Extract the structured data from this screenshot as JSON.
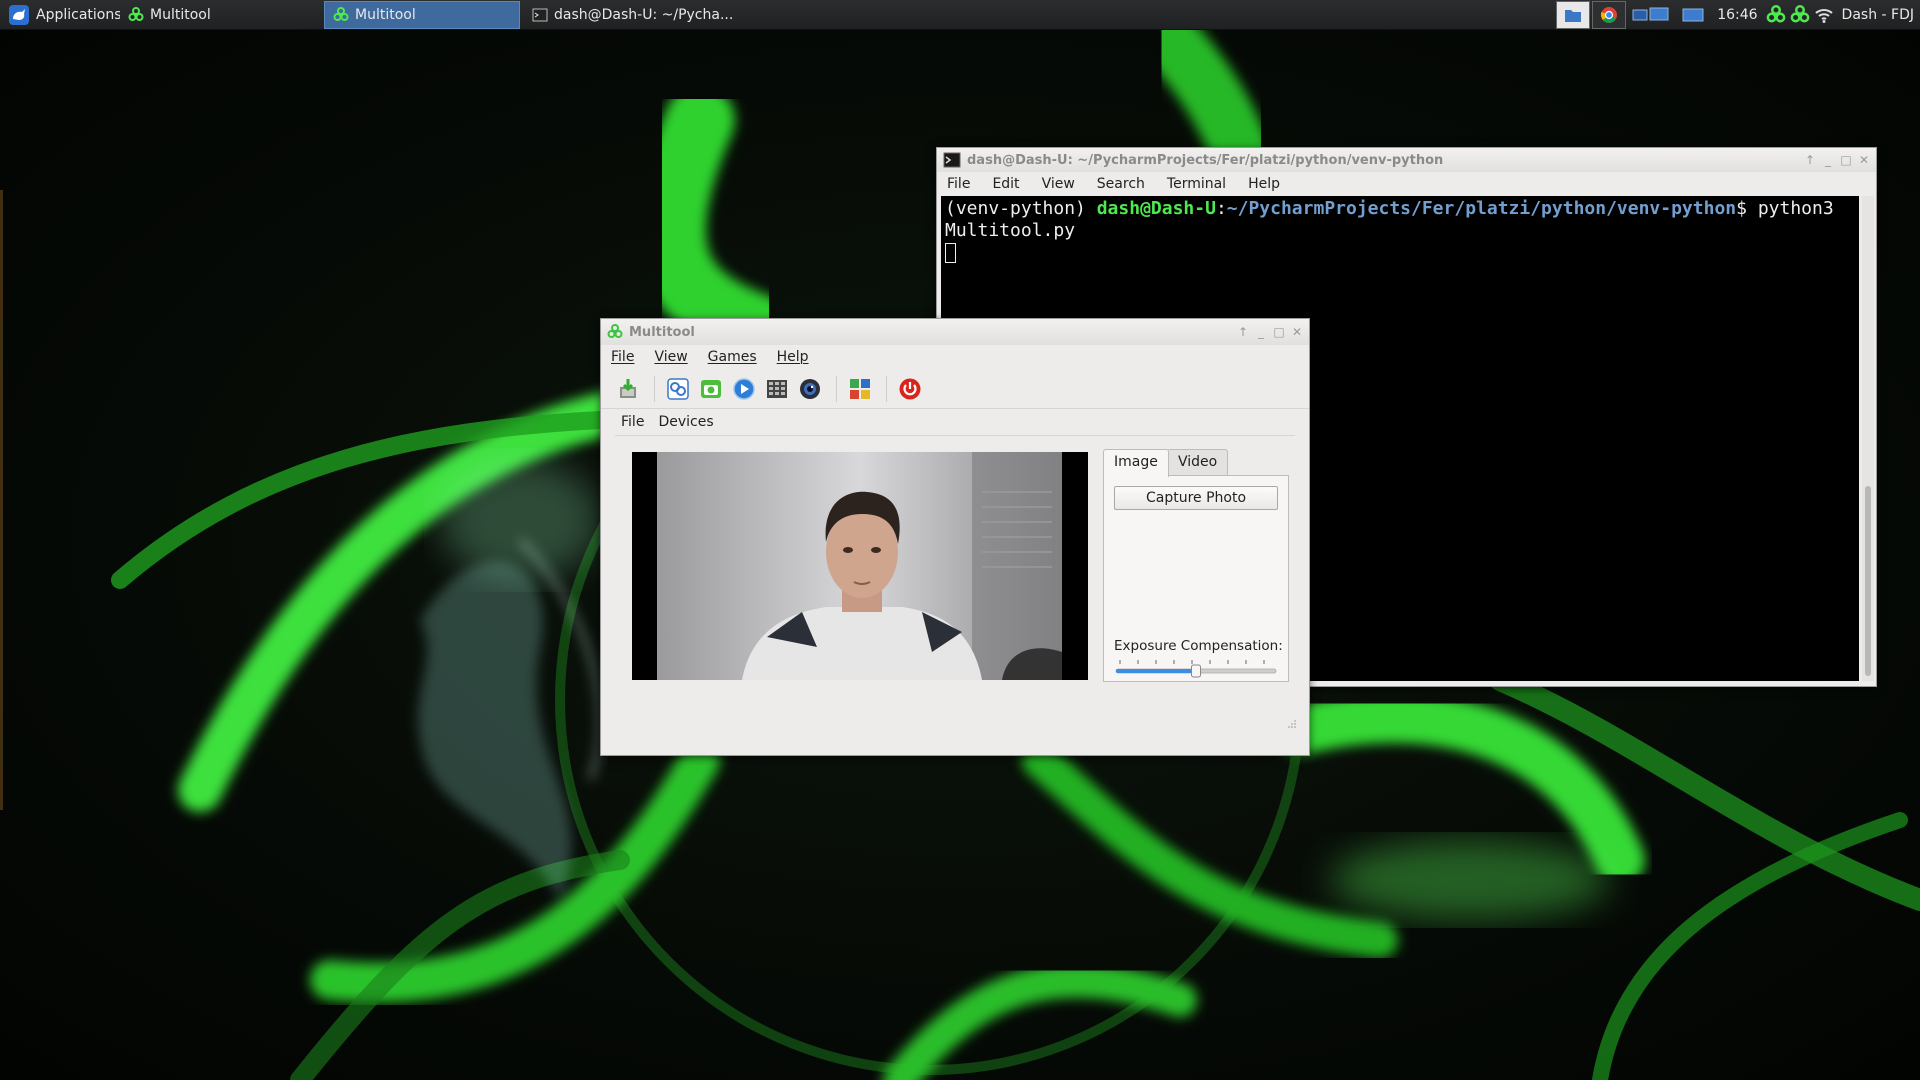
{
  "panel": {
    "apps_label": "Applications",
    "tasks": [
      {
        "label": "Multitool",
        "icon": "biohazard-icon"
      },
      {
        "label": "Multitool",
        "icon": "biohazard-icon"
      },
      {
        "label": "dash@Dash-U: ~/Pycha...",
        "icon": "terminal-icon"
      }
    ],
    "clock": "16:46",
    "user": "Dash - FDJ",
    "tray_icons": [
      "file-manager-icon",
      "chrome-icon",
      "workspace-1-icon",
      "workspace-2-icon",
      "biohazard-icon",
      "biohazard-icon",
      "wifi-icon"
    ]
  },
  "terminal": {
    "title": "dash@Dash-U: ~/PycharmProjects/Fer/platzi/python/venv-python",
    "menu": [
      "File",
      "Edit",
      "View",
      "Search",
      "Terminal",
      "Help"
    ],
    "prompt_env": "(venv-python) ",
    "prompt_user": "dash@Dash-U",
    "prompt_sep": ":",
    "prompt_path": "~/PycharmProjects/Fer/platzi/python/venv-python",
    "prompt_end": "$ ",
    "command_part1": "python3",
    "command_part2": "Multitool.py"
  },
  "multitool": {
    "title": "Multitool",
    "menu": [
      "File",
      "View",
      "Games",
      "Help"
    ],
    "toolbar_icons": [
      "install-icon",
      "link-icon",
      "camera-icon",
      "play-icon",
      "calculator-icon",
      "webcam-icon",
      "apps-grid-icon",
      "power-icon"
    ],
    "inner_menu": [
      "File",
      "Devices"
    ],
    "tabs": {
      "image": "Image",
      "video": "Video"
    },
    "capture_button": "Capture Photo",
    "exposure_label": "Exposure Compensation:",
    "exposure_value_fraction": 0.5
  },
  "colors": {
    "accent_green": "#4ee94e",
    "path_blue": "#729fcf",
    "panel_highlight": "#3e6a9e"
  }
}
